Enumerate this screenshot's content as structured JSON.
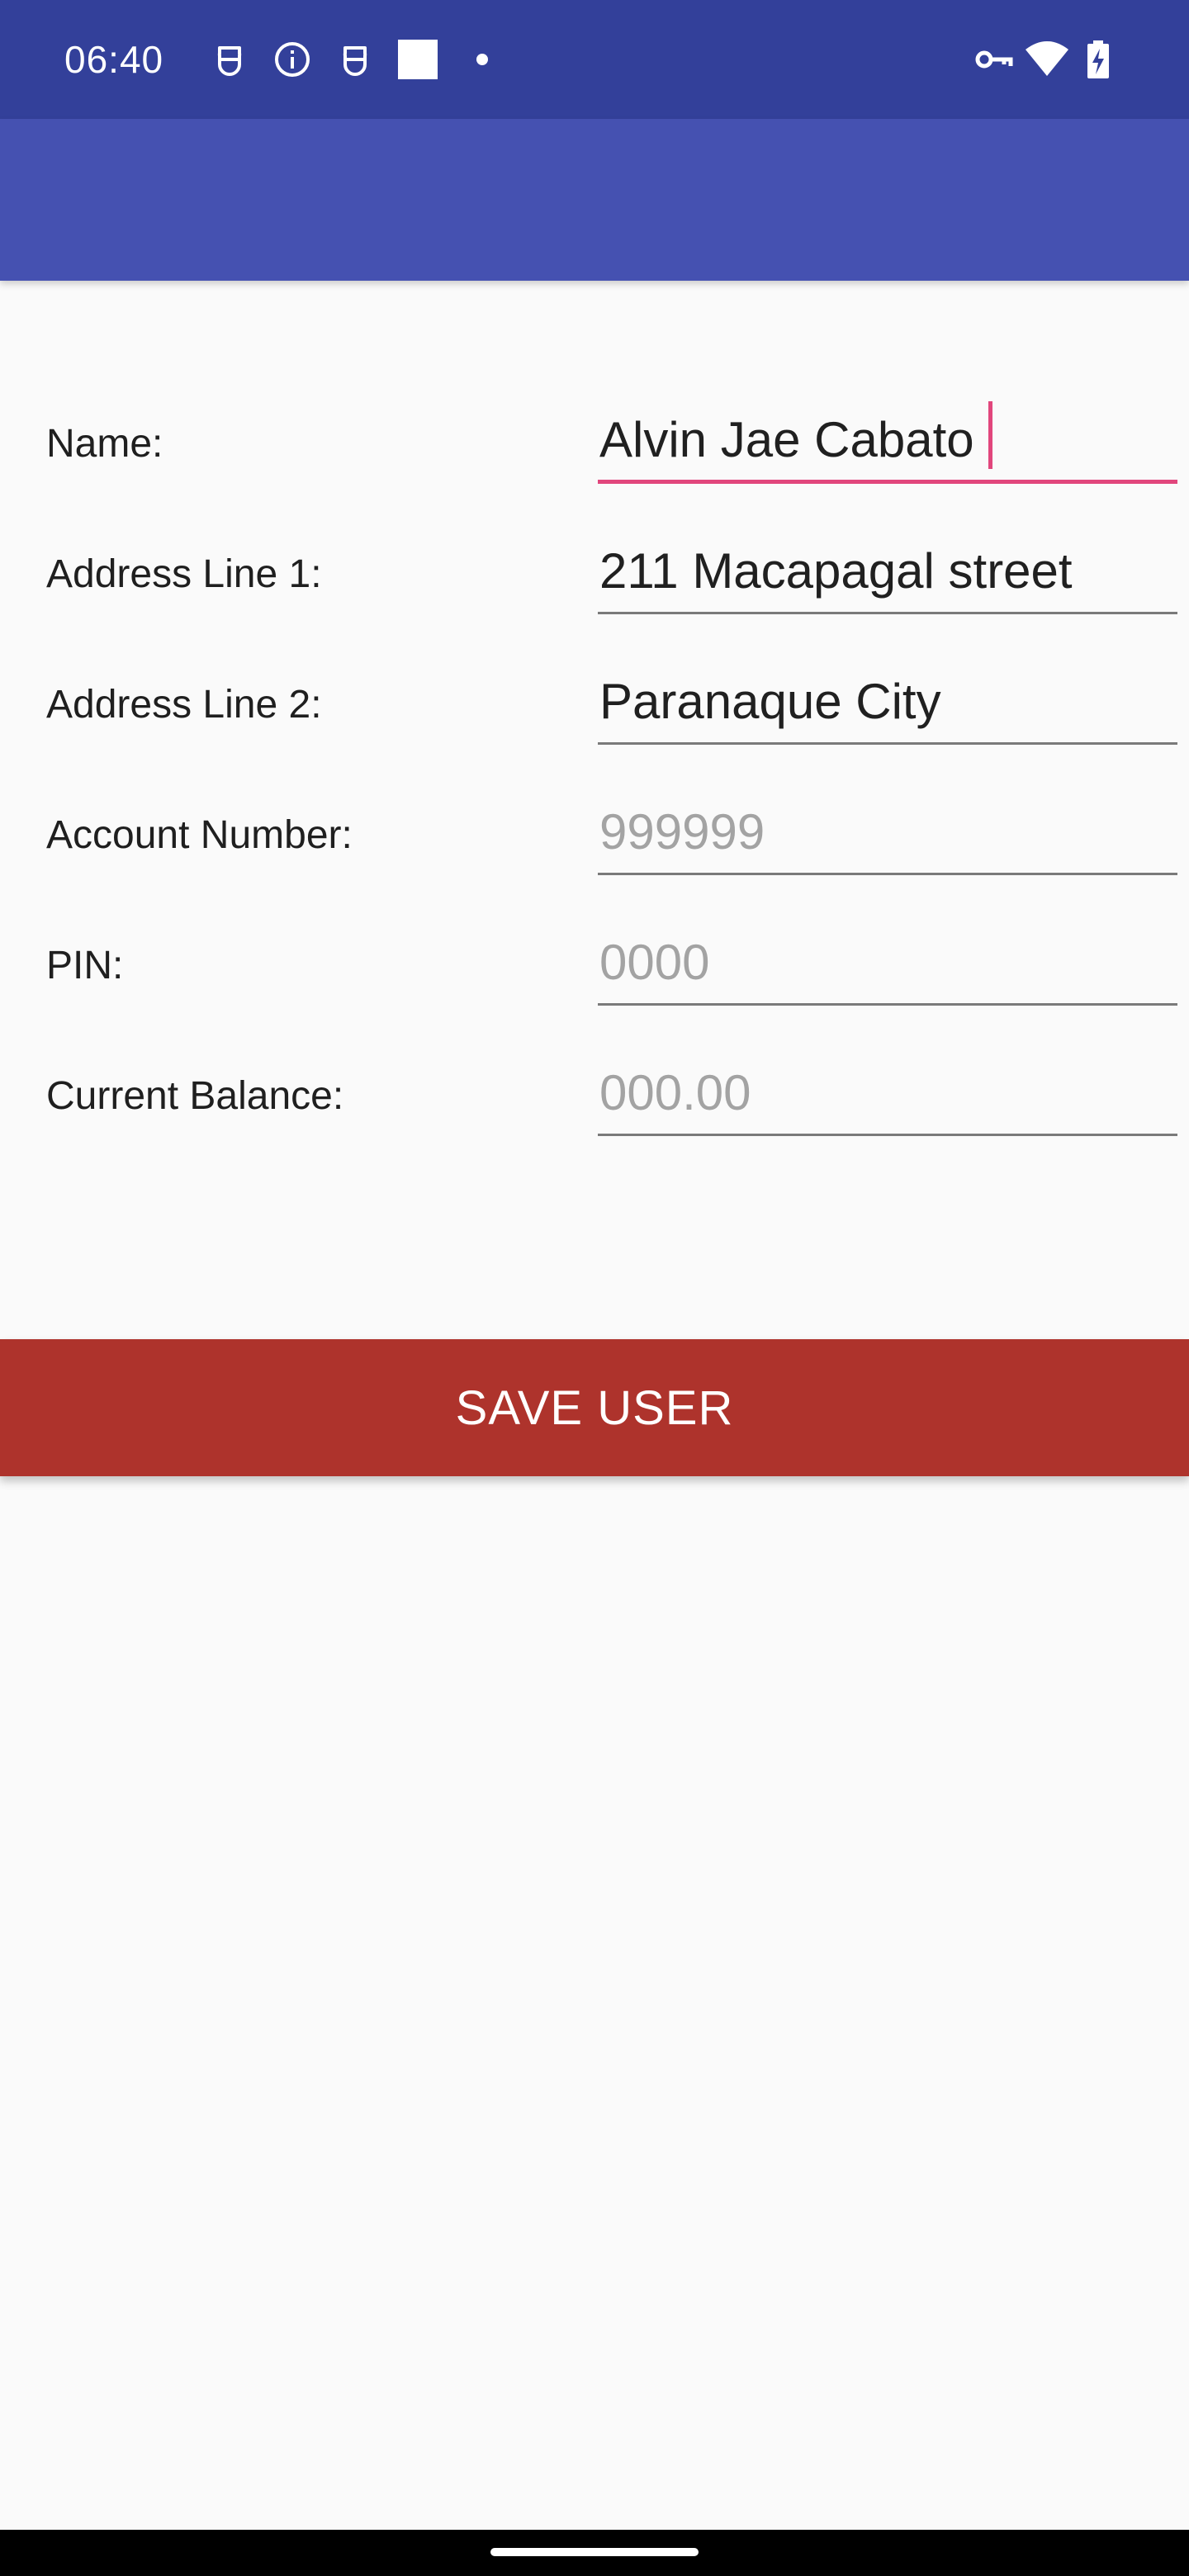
{
  "status_bar": {
    "time": "06:40",
    "icons_left": [
      "face-notification-icon",
      "info-icon",
      "face-notification-icon",
      "square-icon",
      "dot-icon"
    ],
    "icons_right": [
      "vpn-key-icon",
      "wifi-icon",
      "battery-charging-icon"
    ],
    "color": "#33409a"
  },
  "app_bar": {
    "color": "#4551b1"
  },
  "form": {
    "fields": [
      {
        "label": "Name:",
        "value": "Alvin Jae Cabato",
        "placeholder": "",
        "focused": true
      },
      {
        "label": "Address Line 1:",
        "value": "211 Macapagal street",
        "placeholder": ""
      },
      {
        "label": "Address Line 2:",
        "value": "Paranaque City",
        "placeholder": ""
      },
      {
        "label": "Account Number:",
        "value": "",
        "placeholder": "999999"
      },
      {
        "label": "PIN:",
        "value": "",
        "placeholder": "0000"
      },
      {
        "label": "Current Balance:",
        "value": "",
        "placeholder": "000.00"
      }
    ],
    "accent_color": "#e1467c"
  },
  "save_button": {
    "label": "SAVE USER",
    "color": "#ae332c"
  }
}
